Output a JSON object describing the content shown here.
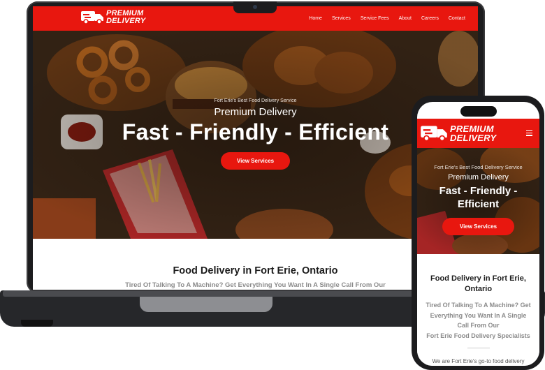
{
  "brand": {
    "line1": "PREMIUM",
    "line2": "DELIVERY",
    "accent": "#e8170f"
  },
  "nav": {
    "items": [
      "Home",
      "Services",
      "Service Fees",
      "About",
      "Careers",
      "Contact"
    ]
  },
  "hero": {
    "kicker": "Fort Erie's Best Food Delivery Service",
    "subtitle": "Premium Delivery",
    "title": "Fast - Friendly - Efficient",
    "button": "View Services"
  },
  "intro": {
    "title": "Food Delivery in Fort Erie, Ontario",
    "subtitle": "Tired Of Talking To A Machine? Get Everything You Want In A Single Call From Our",
    "subtitle_line2": "Fort Erie Food Delivery Specialists",
    "body_start": "We are Fort Erie's go-to food delivery"
  },
  "mobile": {
    "hero_title_line1": "Fast - Friendly -",
    "hero_title_line2": "Efficient",
    "section_title_line1": "Food Delivery in Fort Erie,",
    "section_title_line2": "Ontario",
    "sub_lines": [
      "Tired Of Talking To A Machine? Get",
      "Everything You Want In A Single",
      "Call From Our"
    ],
    "menu_icon": "hamburger-icon"
  }
}
